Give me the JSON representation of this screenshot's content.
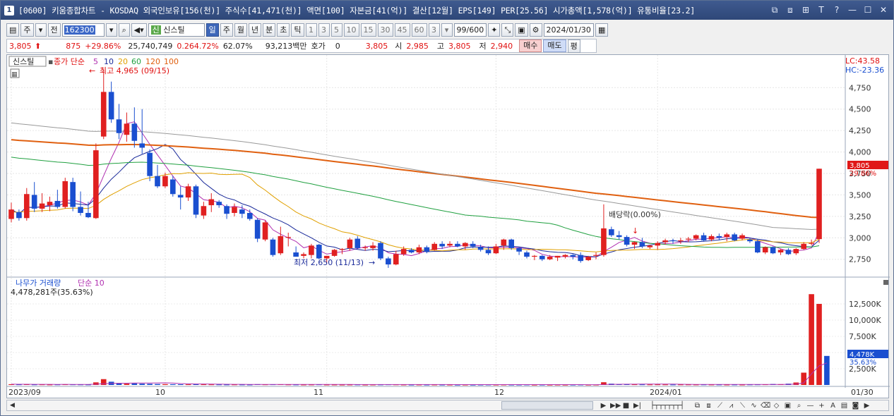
{
  "window": {
    "app_icon": "1",
    "title": "[0600] 키움종합차트 - KOSDAQ 외국인보유[156(천)] 주식수[41,471(천)] 액면[100] 자본금[41(억)] 결산[12월] EPS[149] PER[25.56] 시가총액[1,578(억)] 유통비율[23.2]",
    "buttons": [
      "⧉",
      "⧈",
      "⊞",
      "T",
      "?",
      "—",
      "☐",
      "✕"
    ]
  },
  "toolbar": {
    "period_type": "주",
    "prev_label": "전",
    "code": "162300",
    "sin_badge": "신",
    "stock_name": "신스틸",
    "period_buttons": [
      "일",
      "주",
      "월",
      "년",
      "분",
      "초",
      "틱"
    ],
    "active_period": "일",
    "interval_buttons": [
      "1",
      "3",
      "5",
      "10",
      "15",
      "30",
      "45",
      "60"
    ],
    "interval_dropdown": "3",
    "count": "99",
    "count_total": "/600",
    "date": "2024/01/30"
  },
  "quote": {
    "price": "3,805",
    "change": "875",
    "change_pct": "+29.86%",
    "volume": "25,740,749",
    "vol_pct": "0.264.72%",
    "turnover": "62.07%",
    "amount": "93,213백만",
    "hoga_label": "호가",
    "hoga": "0",
    "price2": "3,805",
    "open_label": "시",
    "open": "2,985",
    "high_label": "고",
    "high": "3,805",
    "low_label": "저",
    "low": "2,940",
    "buy": "매수",
    "sell": "매도",
    "eval": "평"
  },
  "chart": {
    "stock_label": "신스틸",
    "price_series_label": "종가 단순",
    "ma_periods": [
      "5",
      "10",
      "20",
      "60",
      "120",
      "100"
    ],
    "ma_colors": [
      "#b030b0",
      "#1a2a9a",
      "#e0a000",
      "#20a040",
      "#e06010",
      "#999999"
    ],
    "high_annot": "최고 4,965 (09/15)",
    "low_annot": "최저 2,650 (11/13)",
    "div_annot": "배당락(0.00%)",
    "lc": "LC:43.58",
    "hc": "HC:-23.36",
    "price_ticks": [
      "4,750",
      "4,500",
      "4,250",
      "4,000",
      "3,750",
      "3,500",
      "3,250",
      "3,000",
      "2,750"
    ],
    "last_price_tag": "3,805",
    "last_pct_tag": "29.86%",
    "volume_label": "나무가 거래량",
    "volume_ma_label": "단순 10",
    "volume_value": "4,478,281주(35.63%)",
    "volume_ticks": [
      "12,500K",
      "10,000K",
      "7,500K",
      "5,000K",
      "2,500K"
    ],
    "vol_tag": "4,478K",
    "vol_pct_tag": "35.63%",
    "date_labels": [
      "2023/09",
      "10",
      "11",
      "12",
      "2024/01",
      "01/30"
    ],
    "up_color": "#e02020",
    "down_color": "#1a4fd0"
  },
  "chart_data": {
    "type": "candlestick",
    "title": "신스틸",
    "ylim": [
      2600,
      4900
    ],
    "candles": [
      {
        "o": 3220,
        "h": 3410,
        "l": 3180,
        "c": 3330
      },
      {
        "o": 3300,
        "h": 3330,
        "l": 3200,
        "c": 3230
      },
      {
        "o": 3230,
        "h": 3580,
        "l": 3200,
        "c": 3510
      },
      {
        "o": 3500,
        "h": 3650,
        "l": 3300,
        "c": 3340
      },
      {
        "o": 3340,
        "h": 3520,
        "l": 3300,
        "c": 3400
      },
      {
        "o": 3380,
        "h": 3480,
        "l": 3310,
        "c": 3420
      },
      {
        "o": 3430,
        "h": 3560,
        "l": 3340,
        "c": 3360
      },
      {
        "o": 3360,
        "h": 3700,
        "l": 3340,
        "c": 3660
      },
      {
        "o": 3650,
        "h": 3700,
        "l": 3310,
        "c": 3360
      },
      {
        "o": 3360,
        "h": 3540,
        "l": 3260,
        "c": 3290
      },
      {
        "o": 3290,
        "h": 3420,
        "l": 3230,
        "c": 3240
      },
      {
        "o": 3230,
        "h": 4100,
        "l": 3220,
        "c": 4020
      },
      {
        "o": 4180,
        "h": 4965,
        "l": 4150,
        "c": 4700
      },
      {
        "o": 4700,
        "h": 4820,
        "l": 4340,
        "c": 4380
      },
      {
        "o": 4380,
        "h": 4560,
        "l": 4150,
        "c": 4220
      },
      {
        "o": 4200,
        "h": 4460,
        "l": 4120,
        "c": 4330
      },
      {
        "o": 4330,
        "h": 4520,
        "l": 4050,
        "c": 4130
      },
      {
        "o": 4100,
        "h": 4500,
        "l": 3980,
        "c": 4050
      },
      {
        "o": 3990,
        "h": 4030,
        "l": 3660,
        "c": 3720
      },
      {
        "o": 3720,
        "h": 3850,
        "l": 3580,
        "c": 3600
      },
      {
        "o": 3600,
        "h": 3760,
        "l": 3580,
        "c": 3720
      },
      {
        "o": 3680,
        "h": 3720,
        "l": 3480,
        "c": 3510
      },
      {
        "o": 3500,
        "h": 3600,
        "l": 3330,
        "c": 3470
      },
      {
        "o": 3470,
        "h": 3630,
        "l": 3430,
        "c": 3600
      },
      {
        "o": 3600,
        "h": 3620,
        "l": 3230,
        "c": 3270
      },
      {
        "o": 3260,
        "h": 3420,
        "l": 3220,
        "c": 3370
      },
      {
        "o": 3380,
        "h": 3520,
        "l": 3300,
        "c": 3450
      },
      {
        "o": 3420,
        "h": 3440,
        "l": 3350,
        "c": 3380
      },
      {
        "o": 3370,
        "h": 3390,
        "l": 3220,
        "c": 3280
      },
      {
        "o": 3290,
        "h": 3400,
        "l": 3250,
        "c": 3360
      },
      {
        "o": 3330,
        "h": 3380,
        "l": 3230,
        "c": 3280
      },
      {
        "o": 3290,
        "h": 3330,
        "l": 3200,
        "c": 3220
      },
      {
        "o": 3210,
        "h": 3230,
        "l": 2950,
        "c": 2990
      },
      {
        "o": 2980,
        "h": 3200,
        "l": 2960,
        "c": 3180
      },
      {
        "o": 2980,
        "h": 3000,
        "l": 2780,
        "c": 2800
      },
      {
        "o": 2820,
        "h": 3130,
        "l": 2800,
        "c": 3020
      },
      {
        "o": 3000,
        "h": 3060,
        "l": 2900,
        "c": 3010
      },
      {
        "o": 2830,
        "h": 2900,
        "l": 2780,
        "c": 2780
      },
      {
        "o": 2790,
        "h": 2830,
        "l": 2760,
        "c": 2810
      },
      {
        "o": 2800,
        "h": 2930,
        "l": 2760,
        "c": 2910
      },
      {
        "o": 2920,
        "h": 2930,
        "l": 2750,
        "c": 2760
      },
      {
        "o": 2760,
        "h": 2790,
        "l": 2700,
        "c": 2790
      },
      {
        "o": 2790,
        "h": 2870,
        "l": 2780,
        "c": 2860
      },
      {
        "o": 2860,
        "h": 2880,
        "l": 2810,
        "c": 2870
      },
      {
        "o": 2880,
        "h": 3000,
        "l": 2850,
        "c": 2980
      },
      {
        "o": 2990,
        "h": 3020,
        "l": 2870,
        "c": 2880
      },
      {
        "o": 2880,
        "h": 2910,
        "l": 2850,
        "c": 2890
      },
      {
        "o": 2880,
        "h": 2950,
        "l": 2850,
        "c": 2910
      },
      {
        "o": 2940,
        "h": 2960,
        "l": 2740,
        "c": 2760
      },
      {
        "o": 2760,
        "h": 2780,
        "l": 2650,
        "c": 2690
      },
      {
        "o": 2690,
        "h": 2850,
        "l": 2680,
        "c": 2810
      },
      {
        "o": 2810,
        "h": 2900,
        "l": 2790,
        "c": 2870
      },
      {
        "o": 2860,
        "h": 2880,
        "l": 2820,
        "c": 2830
      },
      {
        "o": 2830,
        "h": 2920,
        "l": 2810,
        "c": 2890
      },
      {
        "o": 2890,
        "h": 2910,
        "l": 2820,
        "c": 2840
      },
      {
        "o": 2860,
        "h": 2950,
        "l": 2850,
        "c": 2930
      },
      {
        "o": 2930,
        "h": 2960,
        "l": 2870,
        "c": 2900
      },
      {
        "o": 2910,
        "h": 2960,
        "l": 2890,
        "c": 2930
      },
      {
        "o": 2930,
        "h": 2960,
        "l": 2890,
        "c": 2900
      },
      {
        "o": 2900,
        "h": 2950,
        "l": 2860,
        "c": 2940
      },
      {
        "o": 2930,
        "h": 2960,
        "l": 2880,
        "c": 2900
      },
      {
        "o": 2890,
        "h": 2920,
        "l": 2840,
        "c": 2860
      },
      {
        "o": 2860,
        "h": 2900,
        "l": 2800,
        "c": 2820
      },
      {
        "o": 2820,
        "h": 2930,
        "l": 2810,
        "c": 2900
      },
      {
        "o": 2910,
        "h": 2990,
        "l": 2860,
        "c": 2980
      },
      {
        "o": 2980,
        "h": 2990,
        "l": 2860,
        "c": 2880
      },
      {
        "o": 2880,
        "h": 2890,
        "l": 2800,
        "c": 2840
      },
      {
        "o": 2830,
        "h": 2850,
        "l": 2760,
        "c": 2780
      },
      {
        "o": 2780,
        "h": 2800,
        "l": 2740,
        "c": 2790
      },
      {
        "o": 2790,
        "h": 2800,
        "l": 2730,
        "c": 2750
      },
      {
        "o": 2750,
        "h": 2800,
        "l": 2740,
        "c": 2780
      },
      {
        "o": 2770,
        "h": 2790,
        "l": 2730,
        "c": 2790
      },
      {
        "o": 2780,
        "h": 2810,
        "l": 2760,
        "c": 2800
      },
      {
        "o": 2800,
        "h": 2810,
        "l": 2750,
        "c": 2780
      },
      {
        "o": 2800,
        "h": 2830,
        "l": 2710,
        "c": 2730
      },
      {
        "o": 2740,
        "h": 2790,
        "l": 2730,
        "c": 2780
      },
      {
        "o": 2790,
        "h": 2830,
        "l": 2750,
        "c": 2800
      },
      {
        "o": 2800,
        "h": 3390,
        "l": 2780,
        "c": 3110
      },
      {
        "o": 3100,
        "h": 3130,
        "l": 3010,
        "c": 3030
      },
      {
        "o": 3030,
        "h": 3080,
        "l": 2980,
        "c": 3010
      },
      {
        "o": 3010,
        "h": 3030,
        "l": 2900,
        "c": 2920
      },
      {
        "o": 2920,
        "h": 2960,
        "l": 2870,
        "c": 2950
      },
      {
        "o": 2950,
        "h": 3000,
        "l": 2880,
        "c": 2900
      },
      {
        "o": 2890,
        "h": 2920,
        "l": 2870,
        "c": 2910
      },
      {
        "o": 2910,
        "h": 2960,
        "l": 2860,
        "c": 2940
      },
      {
        "o": 2950,
        "h": 2990,
        "l": 2920,
        "c": 2970
      },
      {
        "o": 2970,
        "h": 2990,
        "l": 2930,
        "c": 2960
      },
      {
        "o": 2960,
        "h": 3000,
        "l": 2930,
        "c": 2970
      },
      {
        "o": 2980,
        "h": 3010,
        "l": 2950,
        "c": 2990
      },
      {
        "o": 2990,
        "h": 3040,
        "l": 2970,
        "c": 3030
      },
      {
        "o": 3030,
        "h": 3060,
        "l": 2960,
        "c": 2970
      },
      {
        "o": 2980,
        "h": 3040,
        "l": 2960,
        "c": 3020
      },
      {
        "o": 3020,
        "h": 3050,
        "l": 2970,
        "c": 3000
      },
      {
        "o": 3010,
        "h": 3060,
        "l": 2960,
        "c": 3040
      },
      {
        "o": 3040,
        "h": 3060,
        "l": 2960,
        "c": 2970
      },
      {
        "o": 2990,
        "h": 3050,
        "l": 2970,
        "c": 3030
      },
      {
        "o": 2980,
        "h": 3000,
        "l": 2940,
        "c": 2960
      },
      {
        "o": 2960,
        "h": 2990,
        "l": 2820,
        "c": 2830
      },
      {
        "o": 2830,
        "h": 2900,
        "l": 2810,
        "c": 2890
      },
      {
        "o": 2890,
        "h": 2900,
        "l": 2810,
        "c": 2820
      },
      {
        "o": 2830,
        "h": 2870,
        "l": 2800,
        "c": 2860
      },
      {
        "o": 2860,
        "h": 2880,
        "l": 2800,
        "c": 2810
      },
      {
        "o": 2820,
        "h": 2880,
        "l": 2800,
        "c": 2870
      },
      {
        "o": 2870,
        "h": 2950,
        "l": 2860,
        "c": 2930
      },
      {
        "o": 2930,
        "h": 2980,
        "l": 2910,
        "c": 2940
      },
      {
        "o": 2985,
        "h": 3805,
        "l": 2940,
        "c": 3805
      }
    ],
    "volume_k": [
      120,
      90,
      110,
      80,
      90,
      70,
      80,
      100,
      90,
      80,
      70,
      400,
      900,
      500,
      300,
      200,
      250,
      200,
      180,
      150,
      130,
      120,
      110,
      100,
      130,
      100,
      90,
      80,
      70,
      80,
      70,
      60,
      120,
      90,
      100,
      110,
      80,
      70,
      60,
      70,
      90,
      60,
      60,
      50,
      60,
      70,
      50,
      60,
      70,
      90,
      80,
      60,
      50,
      60,
      50,
      60,
      50,
      50,
      40,
      50,
      40,
      50,
      60,
      50,
      60,
      50,
      50,
      60,
      40,
      50,
      40,
      50,
      40,
      50,
      60,
      40,
      50,
      420,
      200,
      150,
      120,
      100,
      90,
      80,
      90,
      80,
      70,
      80,
      80,
      70,
      80,
      70,
      70,
      60,
      70,
      60,
      80,
      90,
      100,
      150,
      120,
      200,
      380,
      1900,
      14000,
      12500,
      4478
    ]
  }
}
